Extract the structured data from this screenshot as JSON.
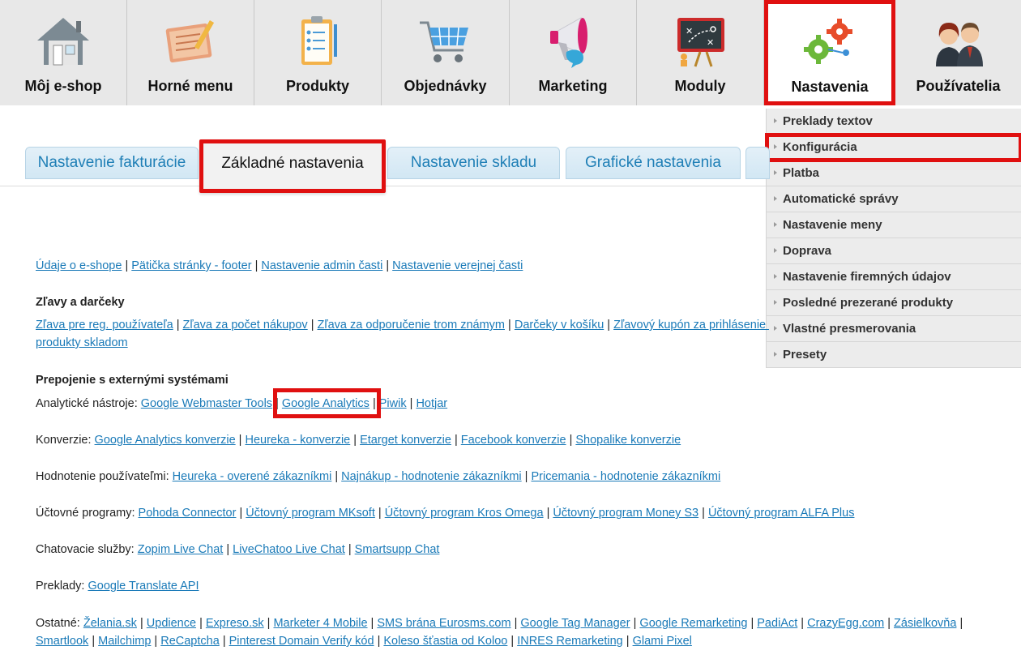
{
  "nav": [
    {
      "label": "Môj e-shop",
      "icon": "house-icon"
    },
    {
      "label": "Horné menu",
      "icon": "notes-pencil-icon"
    },
    {
      "label": "Produkty",
      "icon": "clipboard-checklist-icon"
    },
    {
      "label": "Objednávky",
      "icon": "shopping-cart-icon"
    },
    {
      "label": "Marketing",
      "icon": "megaphone-icon"
    },
    {
      "label": "Moduly",
      "icon": "strategy-board-icon"
    },
    {
      "label": "Nastavenia",
      "icon": "gears-icon",
      "active": true
    },
    {
      "label": "Používatelia",
      "icon": "users-icon"
    }
  ],
  "dropdown": [
    "Preklady textov",
    "Konfigurácia",
    "Platba",
    "Automatické správy",
    "Nastavenie meny",
    "Doprava",
    "Nastavenie firemných údajov",
    "Posledné prezerané produkty",
    "Vlastné presmerovania",
    "Presety"
  ],
  "tabs": [
    "Nastavenie fakturácie",
    "Základné nastavenia",
    "Nastavenie skladu",
    "Grafické nastavenia"
  ],
  "content": {
    "top_links": [
      "Údaje o e-shope",
      "Pätička stránky - footer",
      "Nastavenie admin časti",
      "Nastavenie verejnej časti"
    ],
    "discounts_heading": "Zľavy a darčeky",
    "discounts_links": [
      "Zľava pre reg. používateľa",
      "Zľava za počet nákupov",
      "Zľava za odporučenie trom známym",
      "Darčeky v košíku",
      "Zľavový kupón za prihlásenie do",
      "produkty skladom"
    ],
    "external_heading": "Prepojenie s externými systémami",
    "analytics_label": "Analytické nástroje:",
    "analytics_links": [
      "Google Webmaster Tools",
      "Google Analytics",
      "Piwik",
      "Hotjar"
    ],
    "conversions_label": "Konverzie:",
    "conversions_links": [
      "Google Analytics konverzie",
      "Heureka - konverzie",
      "Etarget konverzie",
      "Facebook konverzie",
      "Shopalike konverzie"
    ],
    "ratings_label": "Hodnotenie používateľmi:",
    "ratings_links": [
      "Heureka - overené zákazníkmi",
      "Najnákup - hodnotenie zákazníkmi",
      "Pricemania - hodnotenie zákazníkmi"
    ],
    "accounting_label": "Účtovné programy:",
    "accounting_links": [
      "Pohoda Connector",
      "Účtovný program MKsoft",
      "Účtovný program Kros Omega",
      "Účtovný program Money S3",
      "Účtovný program ALFA Plus"
    ],
    "chat_label": "Chatovacie služby:",
    "chat_links": [
      "Zopim Live Chat",
      "LiveChatoo Live Chat",
      "Smartsupp Chat"
    ],
    "translate_label": "Preklady:",
    "translate_links": [
      "Google Translate API"
    ],
    "other_label": "Ostatné:",
    "other_links": [
      "Želania.sk",
      "Updience",
      "Expreso.sk",
      "Marketer 4 Mobile",
      "SMS brána Eurosms.com",
      "Google Tag Manager",
      "Google Remarketing",
      "PadiAct",
      "CrazyEgg.com",
      "Zásielkovňa",
      "Smartlook",
      "Mailchimp",
      "ReCaptcha",
      "Pinterest Domain Verify kód",
      "Koleso šťastia od Koloo",
      "INRES Remarketing",
      "Glami Pixel"
    ]
  },
  "colors": {
    "highlight": "#e01010",
    "link": "#1a7ab8",
    "tab_text": "#1f7fb6"
  }
}
